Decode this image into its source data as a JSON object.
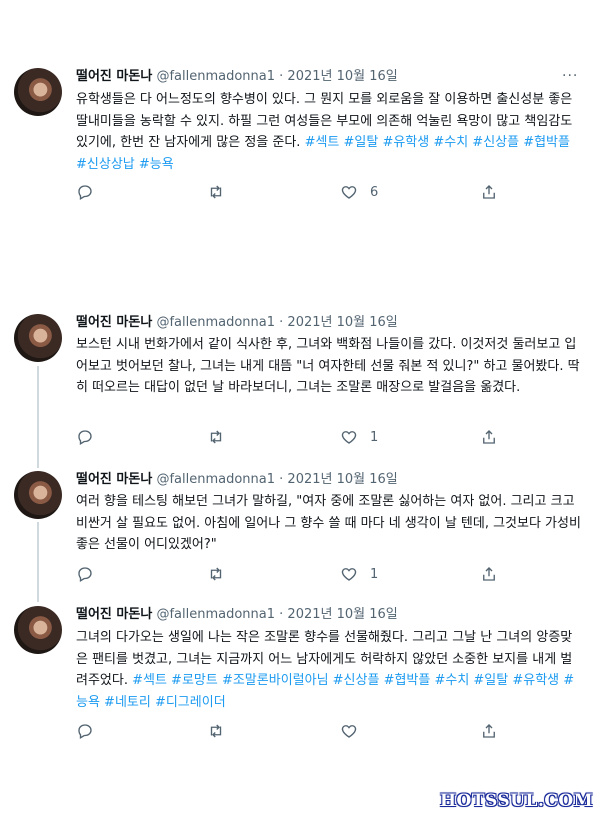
{
  "tweets": [
    {
      "name": "떨어진 마돈나",
      "handle": "@fallenmadonna1",
      "dot": "·",
      "date": "2021년 10월 16일",
      "more": "···",
      "text": "유학생들은 다 어느정도의 향수병이 있다. 그 뭔지 모를 외로움을 잘 이용하면 출신성분 좋은 딸내미들을 농락할 수 있지. 하필 그런 여성들은 부모에 의존해 억눌린 욕망이 많고 책임감도 있기에, 한번 잔 남자에게 많은 정을 준다.",
      "tags": "#섹트 #일탈 #유학생 #수치 #신상플 #협박플 #신상상납 #능욕",
      "likes": "6",
      "retweets": "",
      "replies": ""
    },
    {
      "name": "떨어진 마돈나",
      "handle": "@fallenmadonna1",
      "dot": "·",
      "date": "2021년 10월 16일",
      "more": "···",
      "text": "보스턴 시내 번화가에서 같이 식사한 후, 그녀와 백화점 나들이를 갔다. 이것저것 둘러보고 입어보고 벗어보던 찰나, 그녀는 내게 대뜸 \"너 여자한테 선물 줘본 적 있니?\" 하고 물어봤다. 딱히 떠오르는 대답이 없던 날 바라보더니, 그녀는 조말론 매장으로 발걸음을 옮겼다.",
      "tags": "",
      "likes": "1",
      "retweets": "",
      "replies": ""
    },
    {
      "name": "떨어진 마돈나",
      "handle": "@fallenmadonna1",
      "dot": "·",
      "date": "2021년 10월 16일",
      "more": "···",
      "text": "여러 향을 테스팅 해보던 그녀가 말하길, \"여자 중에 조말론 싫어하는 여자 없어. 그리고 크고 비싼거 살 필요도 없어. 아침에 일어나 그 향수 쓸 때 마다 네 생각이 날 텐데, 그것보다 가성비 좋은 선물이 어디있겠어?\"",
      "tags": "",
      "likes": "1",
      "retweets": "",
      "replies": ""
    },
    {
      "name": "떨어진 마돈나",
      "handle": "@fallenmadonna1",
      "dot": "·",
      "date": "2021년 10월 16일",
      "more": "···",
      "text": "그녀의 다가오는 생일에 나는 작은 조말론 향수를 선물해줬다. 그리고 그날 난 그녀의 앙증맞은 팬티를 벗겼고, 그녀는 지금까지 어느 남자에게도 허락하지 않았던 소중한 보지를 내게 벌려주었다. ",
      "tags": "#섹트 #로망트 #조말론바이럴아님 #신상플 #협박플 #수치 #일탈 #유학생 #능욕 #네토리 #디그레이더",
      "likes": "",
      "retweets": "",
      "replies": ""
    }
  ],
  "icons": {
    "reply": "reply-icon",
    "retweet": "retweet-icon",
    "like": "heart-icon",
    "share": "share-icon"
  },
  "colors": {
    "link": "#1d9bf0",
    "muted": "#536471",
    "thread_line": "#cfd9de"
  },
  "watermark": "HOTSSUL.COM"
}
